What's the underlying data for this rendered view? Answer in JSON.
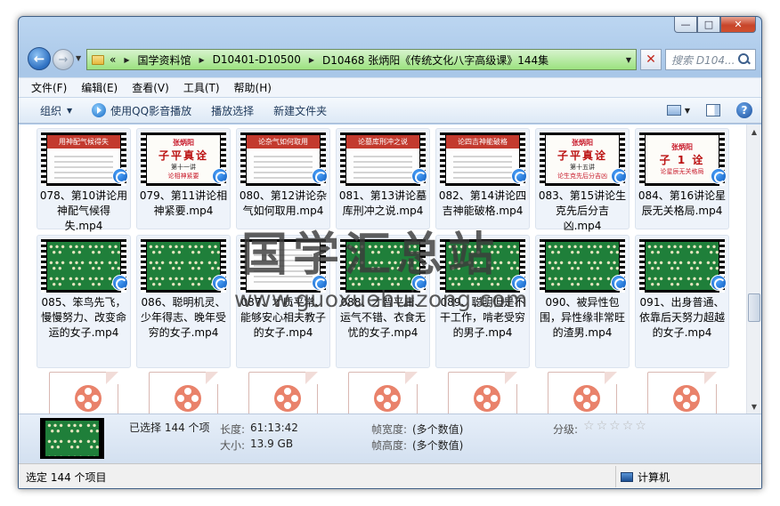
{
  "window": {
    "caption_buttons": [
      "—",
      "□",
      "✕"
    ]
  },
  "address": {
    "crumbs": [
      "国学资料馆",
      "D10401-D10500",
      "D10468 张炳阳《传统文化八字高级课》144集"
    ],
    "overflow": "«",
    "search_placeholder": "搜索 D104..."
  },
  "menu": [
    "文件(F)",
    "编辑(E)",
    "查看(V)",
    "工具(T)",
    "帮助(H)"
  ],
  "toolbar": {
    "organize": "组织",
    "play_qq": "使用QQ影音播放",
    "play_selection": "播放选择",
    "new_folder": "新建文件夹",
    "help": "?"
  },
  "files": [
    {
      "name": "078、第10讲论用神配气候得失.mp4",
      "thumb": "slide",
      "head": "用神配气候得失"
    },
    {
      "name": "079、第11讲论相神紧要.mp4",
      "thumb": "title",
      "t1": "张炳阳",
      "t2": "子平真诠",
      "t3": "第十一讲",
      "t4": "论相神紧要"
    },
    {
      "name": "080、第12讲论杂气如何取用.mp4",
      "thumb": "slide",
      "head": "论杂气如何取用"
    },
    {
      "name": "081、第13讲论墓库刑冲之说.mp4",
      "thumb": "slide",
      "head": "论墓库刑冲之说"
    },
    {
      "name": "082、第14讲论四吉神能破格.mp4",
      "thumb": "slide",
      "head": "论四吉神能破格"
    },
    {
      "name": "083、第15讲论生克先后分吉凶.mp4",
      "thumb": "title",
      "t1": "张炳阳",
      "t2": "子平真诠",
      "t3": "第十五讲",
      "t4": "论生克先后分吉凶"
    },
    {
      "name": "084、第16讲论星辰无关格局.mp4",
      "thumb": "title",
      "t1": "张炳阳",
      "t2": "子 1 诠",
      "t3": "",
      "t4": "论星辰无关格局"
    },
    {
      "name": "085、笨鸟先飞，慢慢努力、改变命运的女子.mp4",
      "thumb": "green"
    },
    {
      "name": "086、聪明机灵、少年得志、晚年受穷的女子.mp4",
      "thumb": "green"
    },
    {
      "name": "087、才质平常、能够安心相夫教子的女子.mp4",
      "thumb": "chart"
    },
    {
      "name": "088、才智平庸、运气不错、衣食无忧的女子.mp4",
      "thumb": "green"
    },
    {
      "name": "089、聪明但是不干工作，啃老受穷的男子.mp4",
      "thumb": "green"
    },
    {
      "name": "090、被异性包围，异性缘非常旺的渣男.mp4",
      "thumb": "green"
    },
    {
      "name": "091、出身普通、依靠后天努力超越的女子.mp4",
      "thumb": "green"
    },
    {
      "name": "",
      "thumb": "doc"
    },
    {
      "name": "",
      "thumb": "doc"
    },
    {
      "name": "",
      "thumb": "doc"
    },
    {
      "name": "",
      "thumb": "doc"
    },
    {
      "name": "",
      "thumb": "doc"
    },
    {
      "name": "",
      "thumb": "doc"
    },
    {
      "name": "",
      "thumb": "doc"
    }
  ],
  "watermark": {
    "title": "国学汇总站",
    "url": "www.guoxuehuizong.com"
  },
  "details": {
    "selected": "已选择 144 个项",
    "length_label": "长度:",
    "length_value": "61:13:42",
    "size_label": "大小:",
    "size_value": "13.9 GB",
    "frame_width_label": "帧宽度:",
    "frame_width_value": "(多个数值)",
    "frame_height_label": "帧高度:",
    "frame_height_value": "(多个数值)",
    "rating_label": "分级:",
    "rating_stars": 0
  },
  "status": {
    "left": "选定 144 个项目",
    "right": "计算机"
  },
  "colors": {
    "address_bar": "#9be27f",
    "accent": "#1e395b",
    "close_button": "#c7452a"
  }
}
